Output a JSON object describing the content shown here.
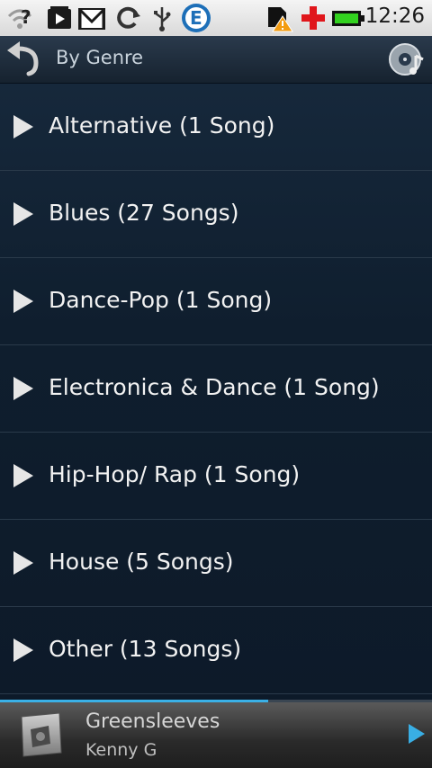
{
  "status_bar": {
    "time": "12:26",
    "icons": [
      "wifi-help-icon",
      "video-play-icon",
      "gmail-icon",
      "sync-icon",
      "usb-icon",
      "app-e-icon",
      "sd-warning-icon",
      "medical-cross-icon",
      "battery-icon"
    ]
  },
  "header": {
    "title": "By Genre"
  },
  "genres": [
    {
      "label": "Alternative (1 Song)"
    },
    {
      "label": "Blues (27 Songs)"
    },
    {
      "label": "Dance-Pop (1 Song)"
    },
    {
      "label": "Electronica & Dance (1 Song)"
    },
    {
      "label": "Hip-Hop/ Rap (1 Song)"
    },
    {
      "label": "House (5 Songs)"
    },
    {
      "label": "Other (13 Songs)"
    }
  ],
  "now_playing": {
    "title": "Greensleeves",
    "artist": "Kenny G",
    "progress": 0.62
  },
  "colors": {
    "accent": "#39aee4",
    "list_bg": "#0e1a28"
  }
}
